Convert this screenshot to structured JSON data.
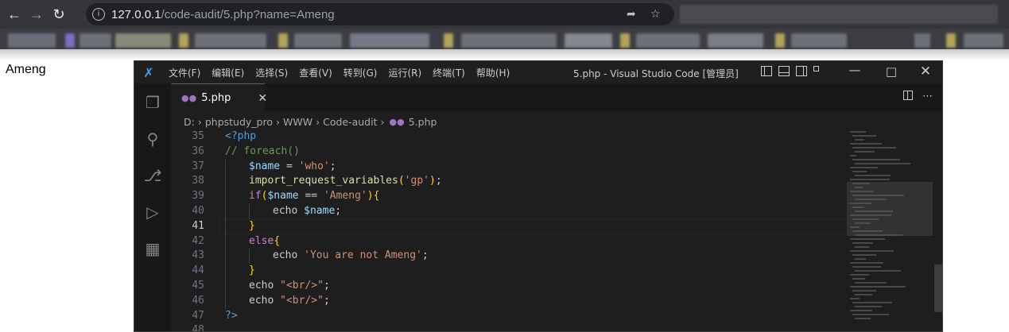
{
  "browser": {
    "url_host": "127.0.0.1",
    "url_path": "/code-audit/5.php?name=Ameng"
  },
  "page_output": "Ameng",
  "vscode": {
    "menu": [
      "文件(F)",
      "编辑(E)",
      "选择(S)",
      "查看(V)",
      "转到(G)",
      "运行(R)",
      "终端(T)",
      "帮助(H)"
    ],
    "window_title": "5.php - Visual Studio Code [管理员]",
    "tab": {
      "label": "5.php"
    },
    "breadcrumb": [
      "D:",
      "phpstudy_pro",
      "WWW",
      "Code-audit",
      "5.php"
    ],
    "active_line": 41,
    "lines": [
      {
        "num": "35",
        "indent": 0,
        "text": "<?php"
      },
      {
        "num": "36",
        "indent": 0,
        "text": "// foreach()"
      },
      {
        "num": "37",
        "indent": 1,
        "text": "$name = 'who';"
      },
      {
        "num": "38",
        "indent": 1,
        "text": "import_request_variables('gp');"
      },
      {
        "num": "39",
        "indent": 1,
        "text": "if($name == 'Ameng'){"
      },
      {
        "num": "40",
        "indent": 2,
        "text": "echo $name;"
      },
      {
        "num": "41",
        "indent": 1,
        "text": "}"
      },
      {
        "num": "42",
        "indent": 1,
        "text": "else{"
      },
      {
        "num": "43",
        "indent": 2,
        "text": "echo 'You are not Ameng';"
      },
      {
        "num": "44",
        "indent": 1,
        "text": "}"
      },
      {
        "num": "45",
        "indent": 1,
        "text": "echo \"<br/>\";"
      },
      {
        "num": "46",
        "indent": 1,
        "text": "echo \"<br/>\";"
      },
      {
        "num": "47",
        "indent": 0,
        "text": "?>"
      },
      {
        "num": "48",
        "indent": 0,
        "text": ""
      }
    ]
  },
  "colors": {
    "accent": "#0078d4",
    "php_icon": "#a074c4",
    "keyword": "#569cd6",
    "string": "#ce9178",
    "variable": "#9cdcfe",
    "comment": "#6a9955"
  }
}
